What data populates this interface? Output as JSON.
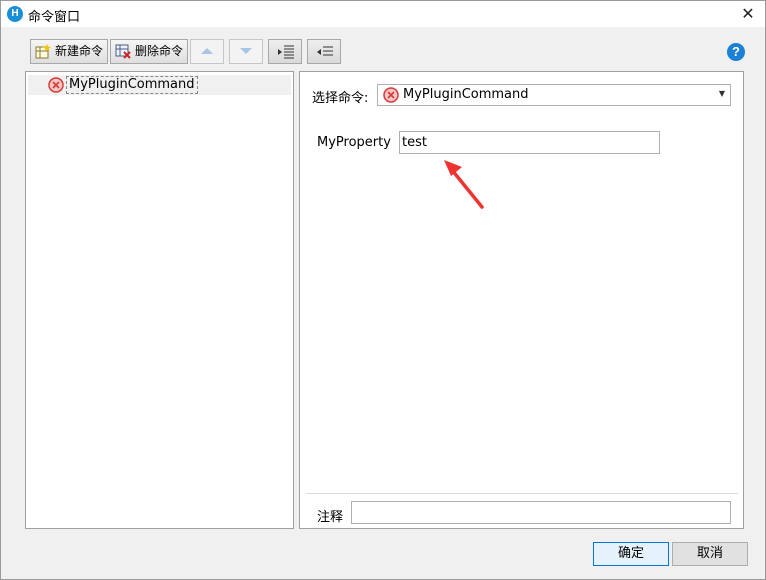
{
  "window": {
    "title": "命令窗口"
  },
  "toolbar": {
    "new_command": "新建命令",
    "delete_command": "删除命令"
  },
  "tree": {
    "items": [
      {
        "label": "MyPluginCommand"
      }
    ]
  },
  "editor": {
    "select_label": "选择命令:",
    "selected_command": "MyPluginCommand",
    "property_label": "MyProperty",
    "property_value": "test",
    "note_label": "注释",
    "note_value": ""
  },
  "footer": {
    "ok": "确定",
    "cancel": "取消"
  },
  "colors": {
    "accent": "#0078d7",
    "error_icon": "#e04a4a",
    "annotation_arrow": "#ee3333",
    "help_icon": "#1b80d6"
  }
}
